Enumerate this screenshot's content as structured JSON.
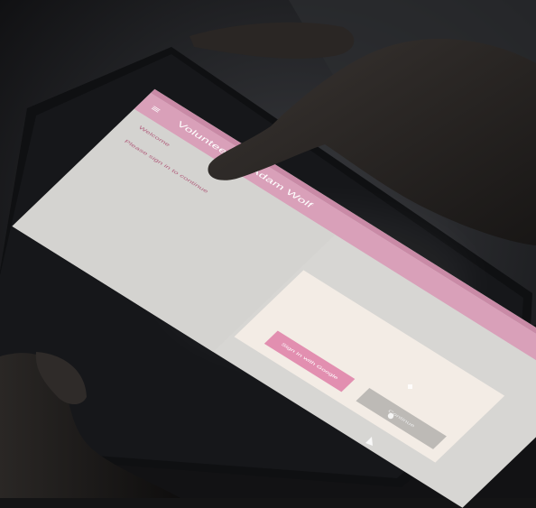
{
  "app": {
    "title": "Volunteer for Adam Wolf",
    "status_items": [
      "",
      ""
    ],
    "line_1": "Welcome",
    "line_2": "Please sign in to continue",
    "primary_button": "Sign In with Google",
    "secondary_button": "Continue"
  },
  "colors": {
    "room_dark": "#141415",
    "tablet_bezel": "#0f1012",
    "status_bar": "#c98aa6",
    "app_bar": "#d9a0b9",
    "primary_button": "#e28fb0",
    "secondary_button": "#bdbab6"
  },
  "nav": {
    "back": "back-icon",
    "home": "home-icon",
    "recents": "recents-icon"
  }
}
